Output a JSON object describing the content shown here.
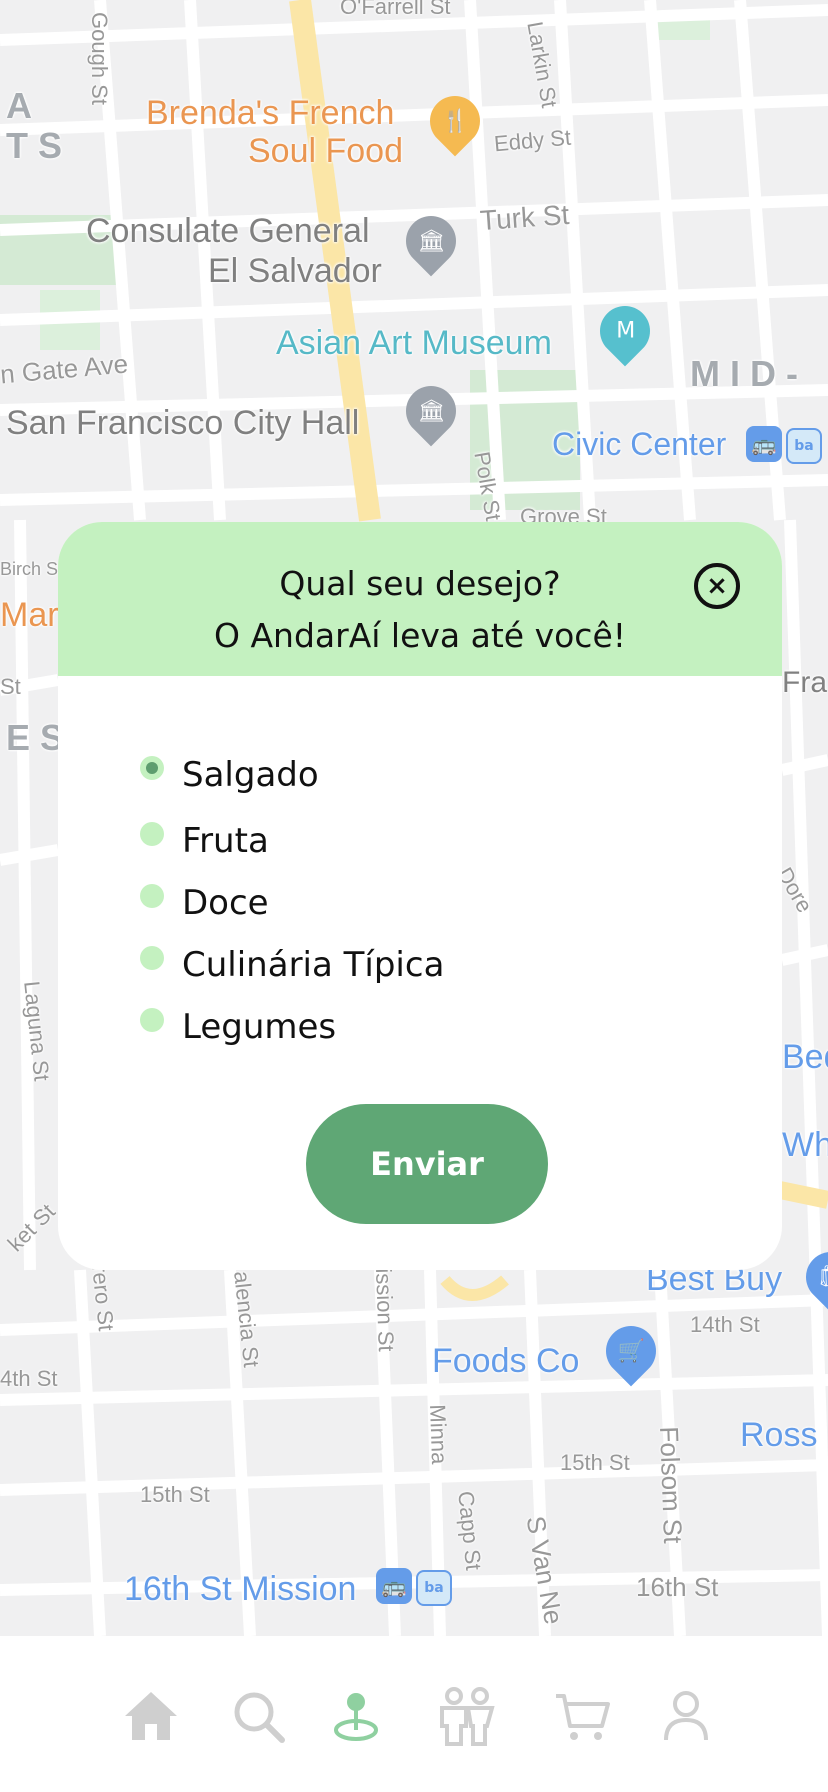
{
  "map": {
    "labels": {
      "ofarrell": "O'Farrell St",
      "gough": "Gough St",
      "larkin": "Larkin St",
      "brendas_1": "Brenda's French",
      "brendas_2": "Soul Food",
      "eddy": "Eddy St",
      "consulate_1": "Consulate General",
      "consulate_2": "El Salvador",
      "turk": "Turk St",
      "asian_art": "Asian Art Museum",
      "mid": "MID-",
      "golden_gate": "n Gate Ave",
      "city_hall": "San Francisco City Hall",
      "civic_center": "Civic Center",
      "polk": "Polk St",
      "grove": "Grove St",
      "birch": "Birch St",
      "mar": "Mar",
      "fra": "Fra",
      "es": "ES",
      "dore": "Dore",
      "laguna": "Laguna St",
      "bed": "Bed",
      "who": "Who",
      "ket": "ket St",
      "rero": "rero St",
      "alencia": "alencia St",
      "ission": "ission St",
      "best_buy": "Best Buy",
      "fourteenth_a": "14th St",
      "fourteenth_b": "4th St",
      "foods_co": "Foods Co",
      "minna": "Minna",
      "ross": "Ross",
      "fifteenth_a": "15th St",
      "fifteenth_b": "15th St",
      "folsom": "Folsom St",
      "capp": "Capp St",
      "svan": "S Van Ne",
      "sixteenth_mission": "16th St Mission",
      "sixteenth": "16th St",
      "ats_a": "A",
      "ats_b": "TS"
    }
  },
  "modal": {
    "title_line1": "Qual seu desejo?",
    "title_line2": "O AndarAí leva até você!",
    "close_label": "×",
    "options": [
      {
        "label": "Salgado",
        "checked": true
      },
      {
        "label": "Fruta",
        "checked": false
      },
      {
        "label": "Doce",
        "checked": false
      },
      {
        "label": "Culinária Típica",
        "checked": false
      },
      {
        "label": "Legumes",
        "checked": false
      }
    ],
    "submit_label": "Enviar"
  },
  "nav": {
    "items": [
      {
        "icon": "home-icon",
        "active": false
      },
      {
        "icon": "search-icon",
        "active": false
      },
      {
        "icon": "location-pin-icon",
        "active": true
      },
      {
        "icon": "people-icon",
        "active": false
      },
      {
        "icon": "cart-icon",
        "active": false
      },
      {
        "icon": "profile-icon",
        "active": false
      }
    ],
    "active_color": "#8fd0a0",
    "inactive_color": "#cfcfcf"
  },
  "colors": {
    "header_bg": "#c4f1c0",
    "button_bg": "#5fa775",
    "radio_fill": "#c4f1c0",
    "radio_dot": "#5e9d6f"
  }
}
